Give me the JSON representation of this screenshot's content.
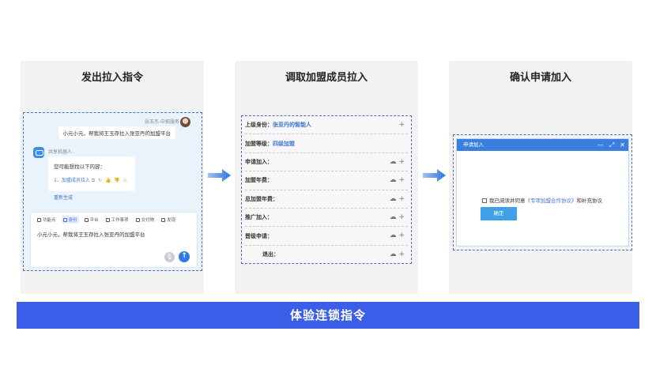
{
  "panels": [
    {
      "title": "发出拉入指令"
    },
    {
      "title": "调取加盟成员拉入"
    },
    {
      "title": "确认申请加入"
    }
  ],
  "chat": {
    "user_name": "张玉杰-中拓服务",
    "user_message": "小元小元，帮我将王玉存拉入张亚丹的加盟平台",
    "bot_name": "共享机器人",
    "bot_question": "您可能想找以下内容：",
    "bot_link": "1、加盟成员拉入",
    "bot_link_icons": "⧉ ↻ 👍 👎 ⚠",
    "regenerate": "重新生成",
    "toolbar": [
      {
        "label": "功能点",
        "active": false
      },
      {
        "label": "身份",
        "active": true
      },
      {
        "label": "平台",
        "active": false
      },
      {
        "label": "工作事项",
        "active": false
      },
      {
        "label": "交付物",
        "active": false
      },
      {
        "label": "发现",
        "active": false
      }
    ],
    "input_text": "小元小元，帮我将王玉存拉入张亚丹的加盟平台",
    "mic_icon": "🎙",
    "send_icon": "↑"
  },
  "form": {
    "rows": [
      {
        "label": "上级身份：",
        "value": "张亚丹的智能人",
        "icons": "+"
      },
      {
        "label": "加盟等级：",
        "value": "四级加盟",
        "icons": ""
      },
      {
        "label": "申请加入：",
        "value": "",
        "icons": "☁ +"
      },
      {
        "label": "加盟年费：",
        "value": "",
        "icons": "☁ +"
      },
      {
        "label": "总加盟年费：",
        "value": "",
        "icons": "☁ +"
      },
      {
        "label": "推广加入：",
        "value": "",
        "icons": "☁ +"
      },
      {
        "label": "晋级申请：",
        "value": "",
        "icons": "☁ +"
      },
      {
        "label": "退出：",
        "value": "",
        "icons": "☁ +"
      }
    ]
  },
  "dialog": {
    "title": "申请加入",
    "controls": [
      "—",
      "⤢",
      "✕"
    ],
    "agree_prefix": "我已阅读并同意",
    "agree_link": "《专项加盟合作协议》",
    "agree_suffix": "和补充协议",
    "ok_label": "确定"
  },
  "banner": {
    "label": "体验连锁指令"
  },
  "colors": {
    "accent": "#3b5ee8",
    "link": "#3d74d6",
    "dialog_header": "#3a7fe0",
    "dashed_border": "#4a6fc9"
  }
}
